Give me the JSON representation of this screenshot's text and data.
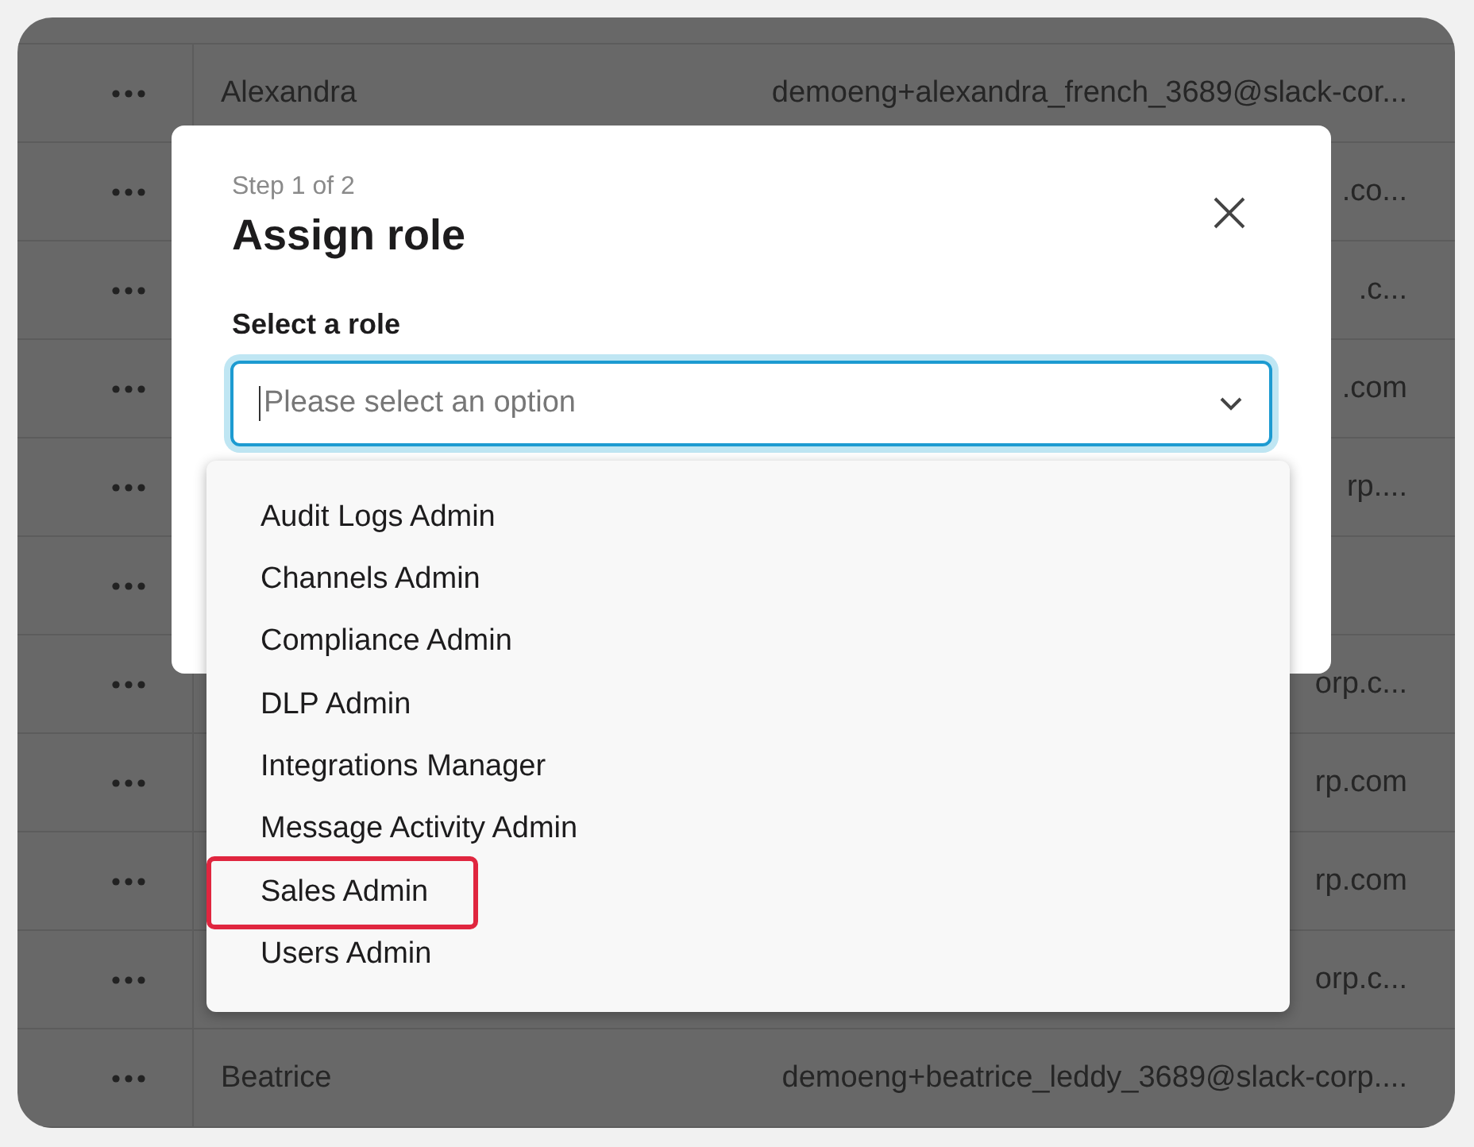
{
  "table": {
    "rows": [
      {
        "name": "Alexandra",
        "email": "demoeng+alexandra_french_3689@slack-cor..."
      },
      {
        "email": ".co..."
      },
      {
        "email": ".c..."
      },
      {
        "email": ".com"
      },
      {
        "email": "rp...."
      },
      {},
      {
        "email": "orp.c..."
      },
      {
        "email": "rp.com"
      },
      {
        "email": "rp.com"
      },
      {
        "email": "orp.c..."
      },
      {
        "name": "Beatrice",
        "email": "demoeng+beatrice_leddy_3689@slack-corp...."
      }
    ]
  },
  "modal": {
    "step": "Step 1 of 2",
    "title": "Assign role",
    "field_label": "Select a role",
    "select": {
      "placeholder": "Please select an option"
    },
    "options": [
      {
        "label": "Audit Logs Admin",
        "highlighted": false
      },
      {
        "label": "Channels Admin",
        "highlighted": false
      },
      {
        "label": "Compliance Admin",
        "highlighted": false
      },
      {
        "label": "DLP Admin",
        "highlighted": false
      },
      {
        "label": "Integrations Manager",
        "highlighted": false
      },
      {
        "label": "Message Activity Admin",
        "highlighted": false
      },
      {
        "label": "Sales Admin",
        "highlighted": true
      },
      {
        "label": "Users Admin",
        "highlighted": false
      }
    ]
  }
}
